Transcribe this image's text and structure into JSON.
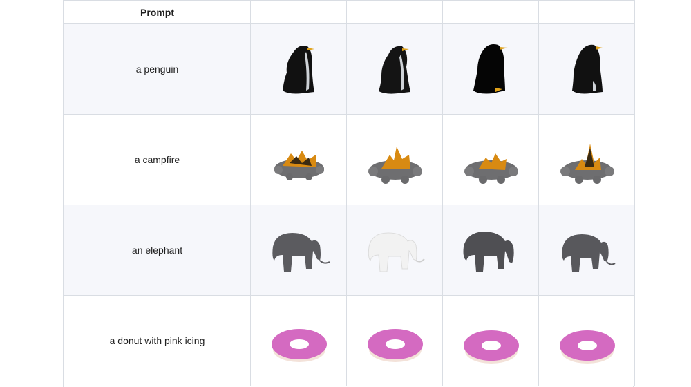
{
  "table": {
    "header": {
      "prompt_label": "Prompt",
      "model_columns": [
        "",
        "",
        "",
        ""
      ]
    },
    "rows": [
      {
        "prompt": "a penguin",
        "subject": "penguin",
        "shaded": true
      },
      {
        "prompt": "a campfire",
        "subject": "campfire",
        "shaded": false
      },
      {
        "prompt": "an elephant",
        "subject": "elephant",
        "shaded": true
      },
      {
        "prompt": "a donut with pink icing",
        "subject": "donut",
        "shaded": false
      }
    ]
  },
  "colors": {
    "grid": "#d9dde3",
    "row_shade": "#f6f7fb",
    "penguin_body": "#111111",
    "penguin_beak": "#e0a21a",
    "campfire_stone": "#6e6e70",
    "campfire_flame": "#d88a12",
    "elephant_gray": "#5b5b5f",
    "elephant_white": "#f2f2f2",
    "donut_icing": "#d46ac1",
    "donut_dough": "#f3e2d9"
  }
}
